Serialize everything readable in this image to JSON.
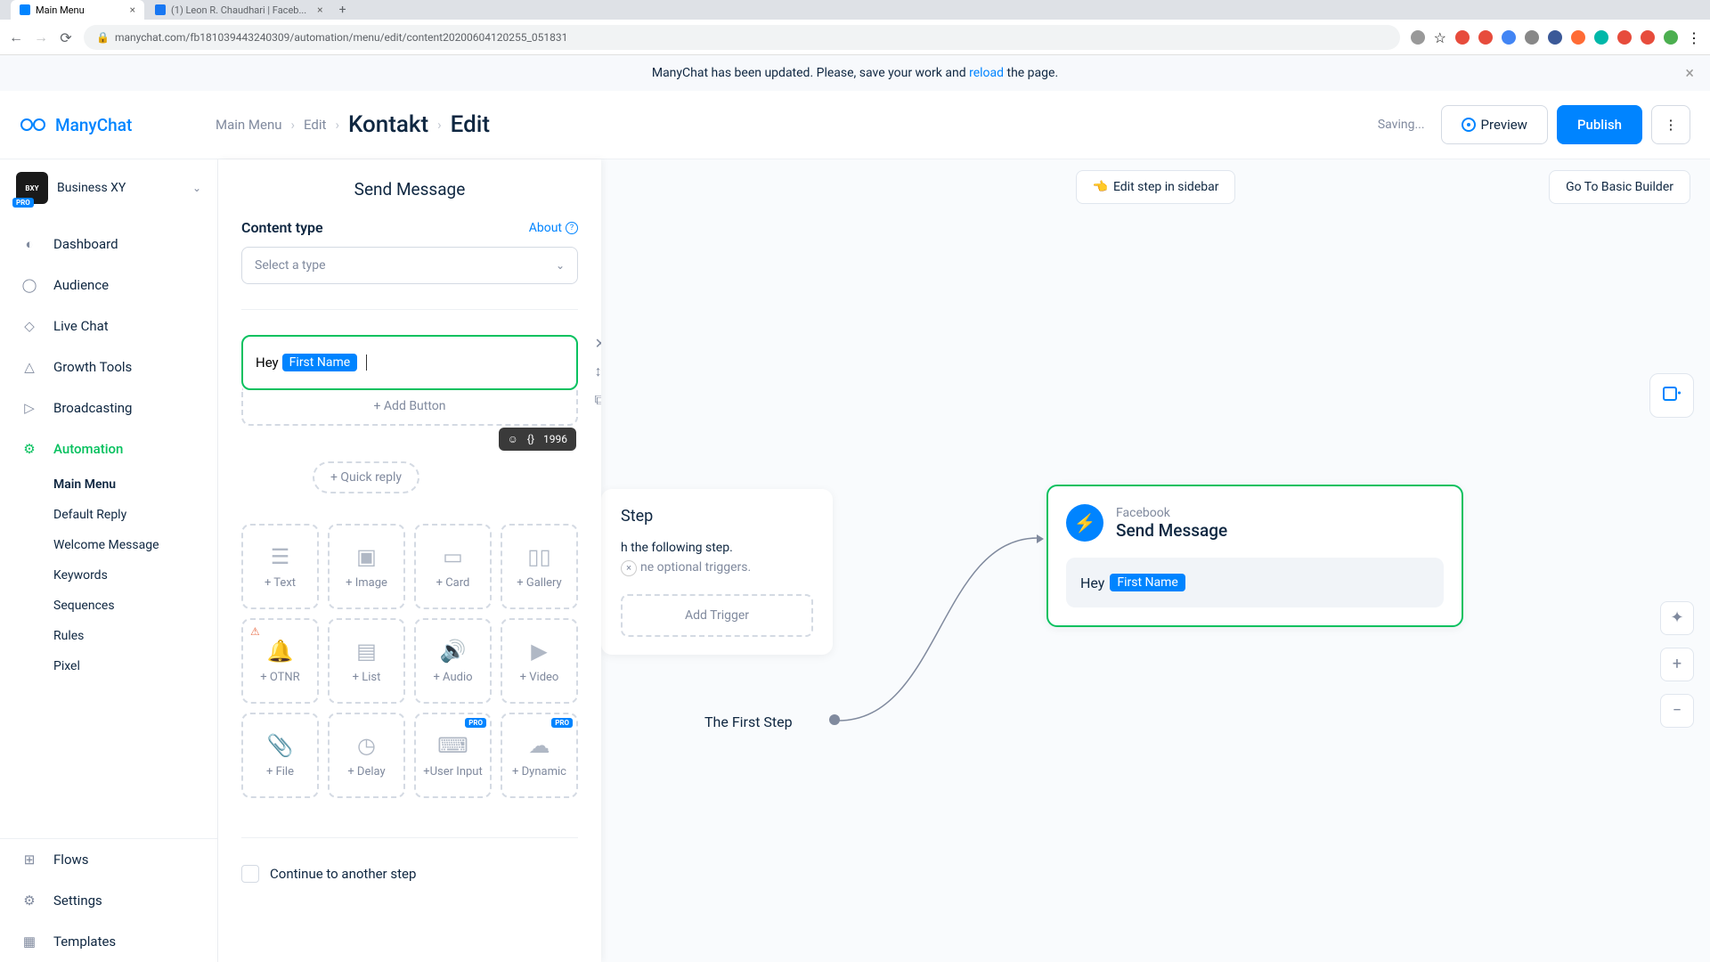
{
  "browser": {
    "tabs": [
      {
        "title": "Main Menu",
        "active": true
      },
      {
        "title": "(1) Leon R. Chaudhari | Faceb...",
        "active": false
      }
    ],
    "url": "manychat.com/fb181039443240309/automation/menu/edit/content20200604120255_051831"
  },
  "notice": {
    "pre": "ManyChat has been updated. Please, save your work and ",
    "link": "reload",
    "post": " the page."
  },
  "topbar": {
    "brand": "ManyChat",
    "breadcrumbs": [
      "Main Menu",
      "Edit",
      "Kontakt",
      "Edit"
    ],
    "saving": "Saving...",
    "preview": "Preview",
    "publish": "Publish"
  },
  "workspace": {
    "name": "Business XY",
    "badge": "PRO"
  },
  "nav": {
    "items": [
      {
        "label": "Dashboard",
        "icon": "gauge"
      },
      {
        "label": "Audience",
        "icon": "user"
      },
      {
        "label": "Live Chat",
        "icon": "chat"
      },
      {
        "label": "Growth Tools",
        "icon": "rocket"
      },
      {
        "label": "Broadcasting",
        "icon": "send"
      },
      {
        "label": "Automation",
        "icon": "gear",
        "active": true
      }
    ],
    "sub": [
      "Main Menu",
      "Default Reply",
      "Welcome Message",
      "Keywords",
      "Sequences",
      "Rules",
      "Pixel"
    ],
    "sub_active": "Main Menu",
    "bottom": [
      {
        "label": "Flows",
        "icon": "flow"
      },
      {
        "label": "Settings",
        "icon": "cog"
      },
      {
        "label": "Templates",
        "icon": "template"
      }
    ]
  },
  "panel": {
    "title": "Send Message",
    "ct_label": "Content type",
    "about": "About",
    "select_ph": "Select a type",
    "msg": {
      "text_pre": "Hey",
      "var": "First Name",
      "chars": "1996"
    },
    "add_button": "+ Add Button",
    "quick_reply": "+ Quick reply",
    "tiles": [
      "+ Text",
      "+ Image",
      "+ Card",
      "+ Gallery",
      "+ OTNR",
      "+ List",
      "+ Audio",
      "+ Video",
      "+ File",
      "+ Delay",
      "+User Input",
      "+ Dynamic"
    ],
    "continue": "Continue to another step"
  },
  "canvas": {
    "edit_step": "Edit step in sidebar",
    "go_basic": "Go To Basic Builder",
    "step_title": "Step",
    "step_desc1": "h the following step.",
    "step_desc2": "ne optional triggers.",
    "add_trigger": "Add Trigger",
    "first_step": "The First Step",
    "card": {
      "channel": "Facebook",
      "title": "Send Message",
      "text_pre": "Hey",
      "var": "First Name"
    }
  }
}
